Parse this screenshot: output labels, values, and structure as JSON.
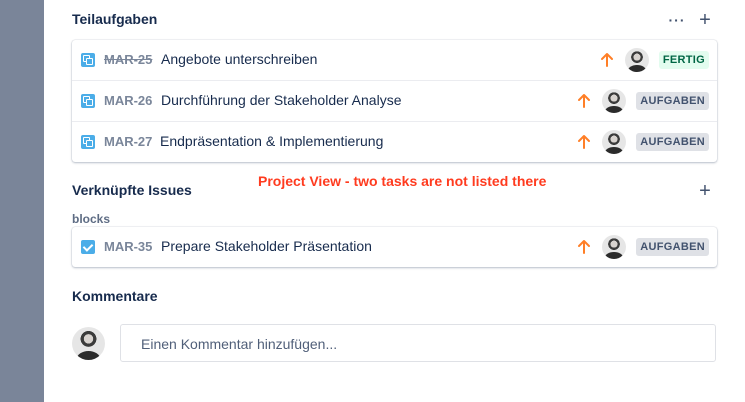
{
  "subtasks": {
    "title": "Teilaufgaben",
    "more_label": "···",
    "add_label": "+",
    "items": [
      {
        "key": "MAR-25",
        "summary": "Angebote unterschreiben",
        "priority": "high",
        "status": "FERTIG",
        "icon": "subtask-icon"
      },
      {
        "key": "MAR-26",
        "summary": "Durchführung der Stakeholder Analyse",
        "priority": "high",
        "status": "AUFGABEN",
        "icon": "subtask-icon"
      },
      {
        "key": "MAR-27",
        "summary": "Endpräsentation & Implementierung",
        "priority": "high",
        "status": "AUFGABEN",
        "icon": "subtask-icon"
      }
    ]
  },
  "annotation": "Project View - two tasks are not listed there",
  "linked_issues": {
    "title": "Verknüpfte Issues",
    "add_label": "+",
    "relation_label": "blocks",
    "items": [
      {
        "key": "MAR-35",
        "summary": "Prepare Stakeholder Präsentation",
        "priority": "high",
        "status": "AUFGABEN",
        "icon": "task-checkbox-icon"
      }
    ]
  },
  "comments": {
    "title": "Kommentare",
    "placeholder": "Einen Kommentar hinzufügen..."
  },
  "colors": {
    "priority_high": "#ff7f27",
    "status_done_bg": "#e3fcef",
    "status_done_text": "#006644",
    "status_todo_bg": "#dfe1e6",
    "status_todo_text": "#42526e",
    "annotation": "#ff3b1f",
    "issue_icon": "#4bade8"
  }
}
